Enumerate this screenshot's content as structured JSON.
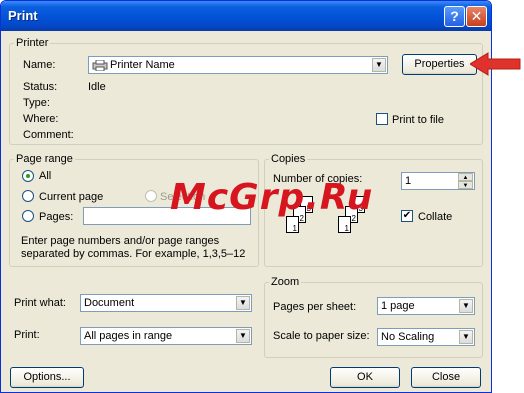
{
  "window": {
    "title": "Print",
    "help_glyph": "?",
    "close_glyph": "✕"
  },
  "printer": {
    "legend": "Printer",
    "name_label": "Name:",
    "name_value": "Printer Name",
    "properties_label": "Properties",
    "status_label": "Status:",
    "status_value": "Idle",
    "type_label": "Type:",
    "where_label": "Where:",
    "comment_label": "Comment:",
    "print_to_file_label": "Print to file",
    "print_to_file_checked": false
  },
  "page_range": {
    "legend": "Page range",
    "all_label": "All",
    "current_label": "Current page",
    "selection_label": "Selection",
    "pages_label": "Pages:",
    "pages_value": "",
    "hint_line1": "Enter page numbers and/or page ranges",
    "hint_line2": "separated by commas.  For example, 1,3,5–12",
    "selected": "all"
  },
  "copies": {
    "legend": "Copies",
    "number_label": "Number of copies:",
    "number_value": "1",
    "collate_label": "Collate",
    "collate_checked": true,
    "pages": [
      "1",
      "2",
      "3"
    ]
  },
  "print_what": {
    "label": "Print what:",
    "value": "Document"
  },
  "print_sel": {
    "label": "Print:",
    "value": "All pages in range"
  },
  "zoom": {
    "legend": "Zoom",
    "pps_label": "Pages per sheet:",
    "pps_value": "1 page",
    "scale_label": "Scale to paper size:",
    "scale_value": "No Scaling"
  },
  "buttons": {
    "options": "Options...",
    "ok": "OK",
    "close": "Close"
  },
  "watermark": "McGrp.Ru",
  "colors": {
    "title_bar": "#0452d6",
    "dialog_bg": "#ece9d8",
    "arrow": "#e0312b",
    "watermark": "#d6151e"
  }
}
